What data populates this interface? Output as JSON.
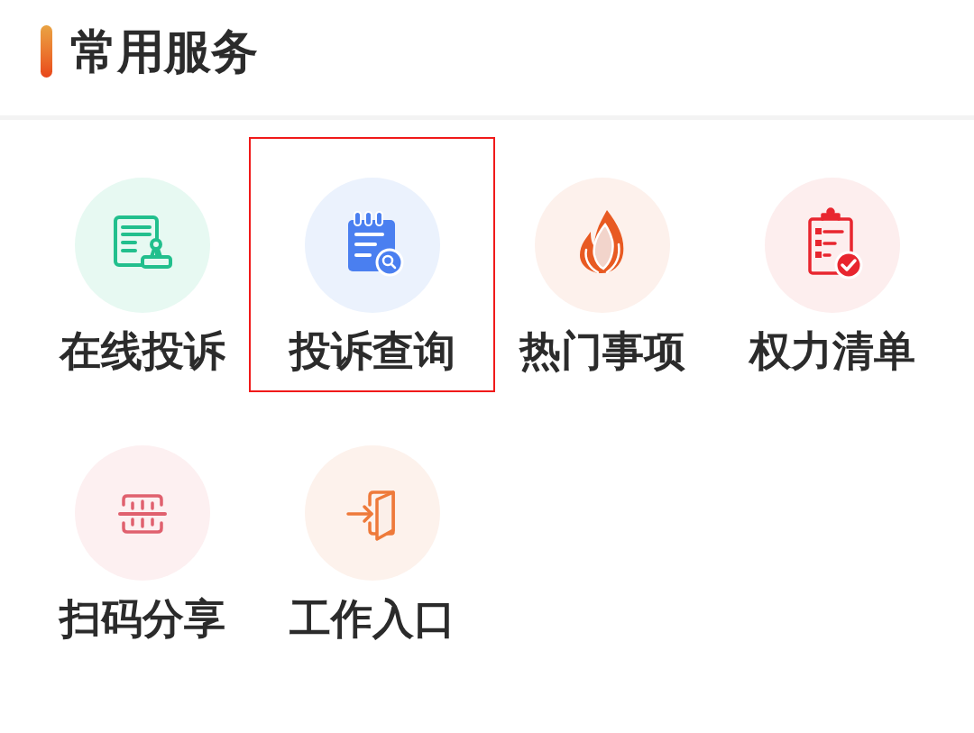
{
  "header": {
    "title": "常用服务"
  },
  "services": [
    {
      "label": "在线投诉",
      "kind": "complaint",
      "selected": false
    },
    {
      "label": "投诉查询",
      "kind": "query",
      "selected": true
    },
    {
      "label": "热门事项",
      "kind": "hot",
      "selected": false
    },
    {
      "label": "权力清单",
      "kind": "list",
      "selected": false
    },
    {
      "label": "扫码分享",
      "kind": "scan",
      "selected": false
    },
    {
      "label": "工作入口",
      "kind": "entry",
      "selected": false
    }
  ]
}
